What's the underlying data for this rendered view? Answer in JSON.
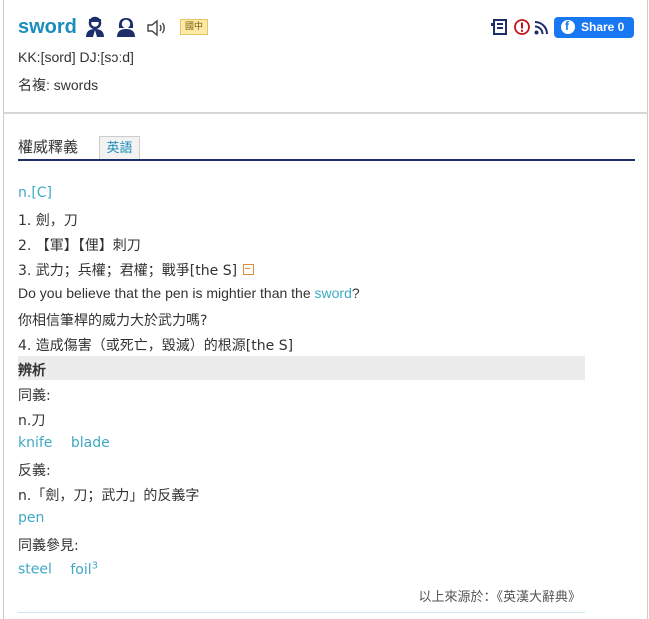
{
  "header": {
    "word": "sword",
    "badge": "國中",
    "kk": "KK:[sord] DJ:[sɔːd]",
    "plural": "名複: swords",
    "share_label": "Share 0"
  },
  "tabs": {
    "main": "權威釋義",
    "english": "英語"
  },
  "entry": {
    "pos": "n.[C]",
    "senses": [
      "1. 劍，刀",
      "2. 【軍】【俚】刺刀",
      "3. 武力；兵權；君權；戰爭[the S]"
    ],
    "example_before": "Do you believe that the pen is mightier than the ",
    "example_link": "sword",
    "example_after": "?",
    "example_translation": "你相信筆桿的威力大於武力嗎?",
    "sense4": "4. 造成傷害（或死亡，毀滅）的根源[the S]"
  },
  "analysis": {
    "heading": "辨析",
    "synonym_label": "同義:",
    "synonym_pos": "n.刀",
    "synonyms": [
      "knife",
      "blade"
    ],
    "antonym_label": "反義:",
    "antonym_desc": "n.「劍，刀；武力」的反義字",
    "antonyms": [
      "pen"
    ],
    "see_also_label": "同義參見:",
    "see_also": [
      "steel",
      "foil"
    ],
    "see_also_sup": "3"
  },
  "source": "以上來源於：《英漢大辭典》"
}
